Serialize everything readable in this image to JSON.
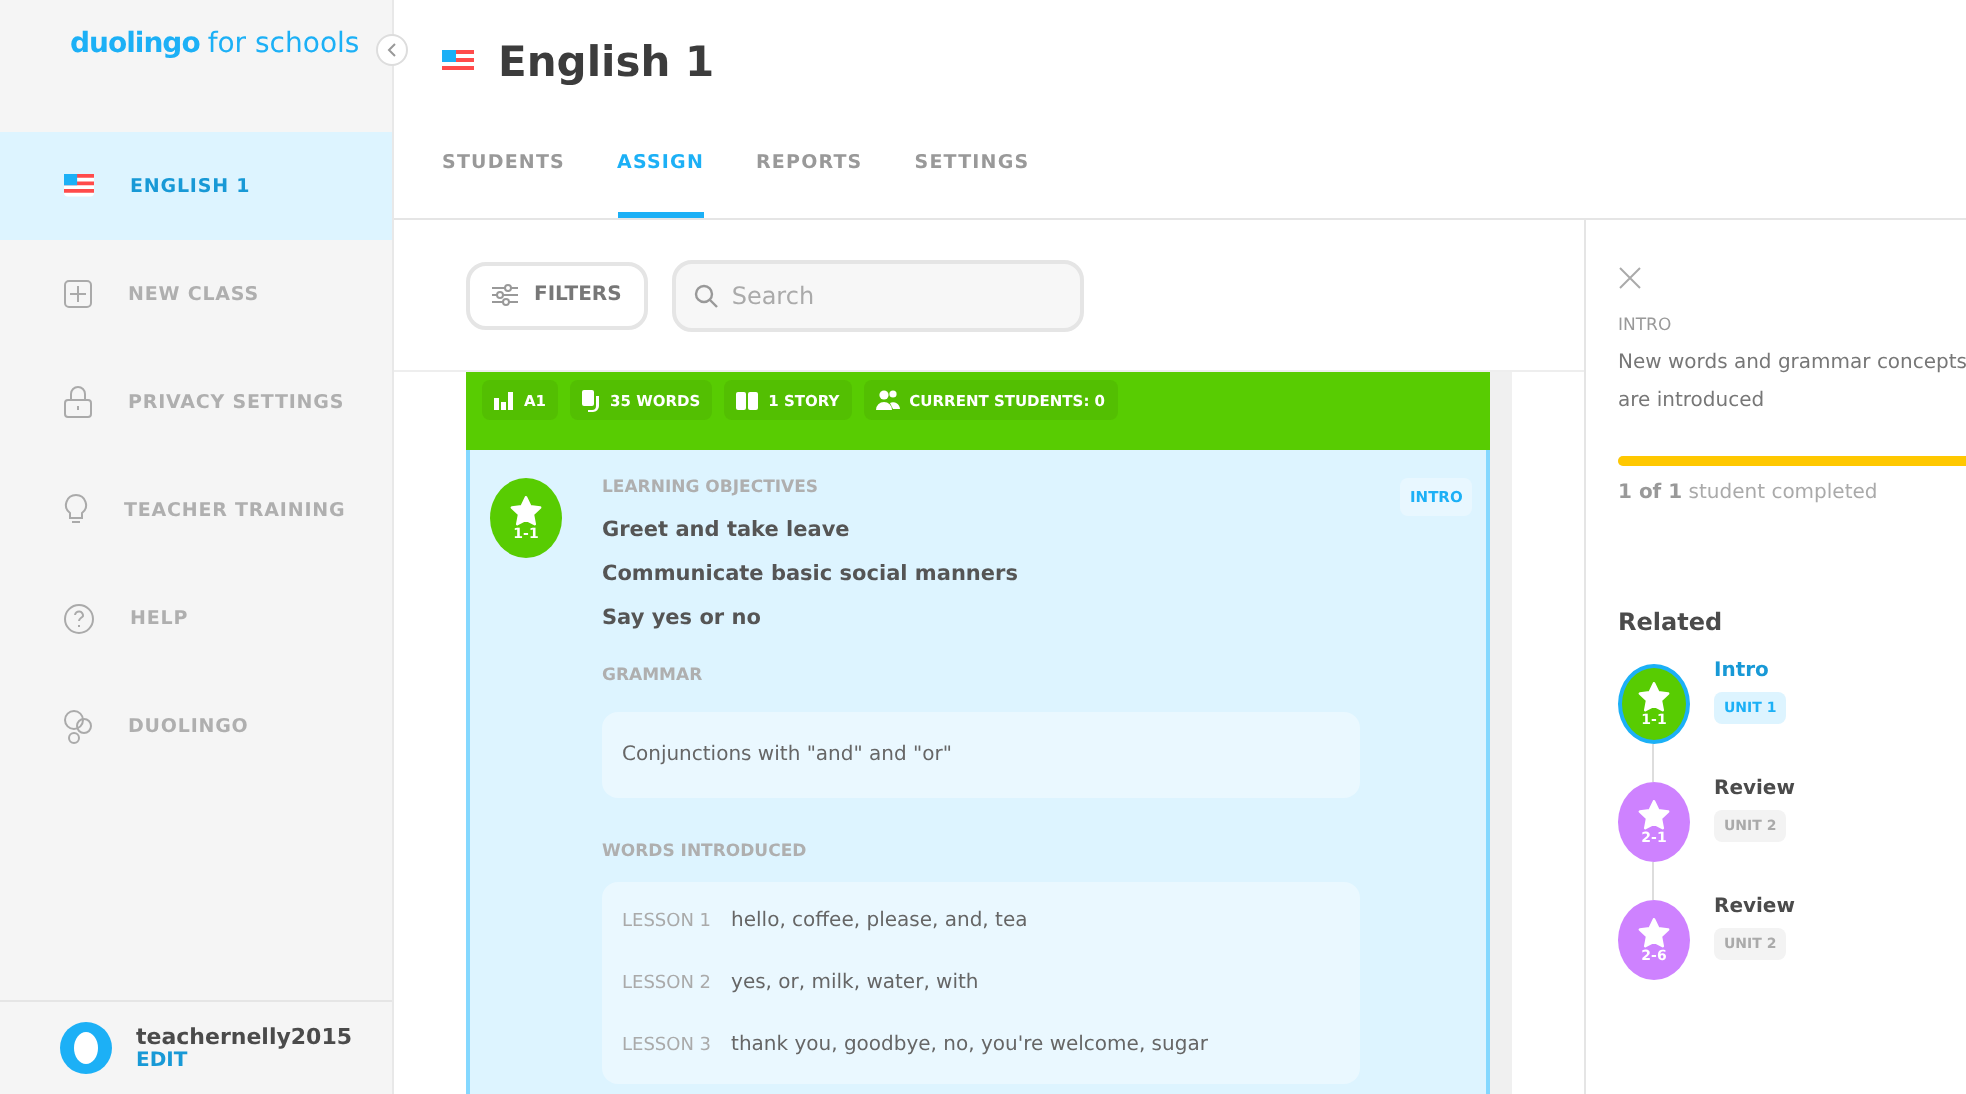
{
  "logo": {
    "brand": "duolingo",
    "suffix": "for schools"
  },
  "sidebar": {
    "items": [
      {
        "label": "ENGLISH 1",
        "selected": true
      },
      {
        "label": "NEW CLASS",
        "selected": false
      },
      {
        "label": "PRIVACY SETTINGS",
        "selected": false
      },
      {
        "label": "TEACHER TRAINING",
        "selected": false
      },
      {
        "label": "HELP",
        "selected": false
      },
      {
        "label": "DUOLINGO",
        "selected": false
      }
    ],
    "user": {
      "name": "teachernelly2015",
      "action": "EDIT"
    }
  },
  "header": {
    "title": "English 1"
  },
  "tabs": [
    {
      "label": "STUDENTS",
      "selected": false
    },
    {
      "label": "ASSIGN",
      "selected": true
    },
    {
      "label": "REPORTS",
      "selected": false
    },
    {
      "label": "SETTINGS",
      "selected": false
    }
  ],
  "toolbar": {
    "filters": "FILTERS",
    "search": {
      "placeholder": "Search"
    }
  },
  "card": {
    "stats": [
      {
        "label": "A1"
      },
      {
        "label": "35 WORDS"
      },
      {
        "label": "1 STORY"
      },
      {
        "label": "CURRENT STUDENTS: 0"
      }
    ],
    "badge": "1-1",
    "tag": "INTRO",
    "objectives_heading": "LEARNING OBJECTIVES",
    "objectives": [
      "Greet and take leave",
      "Communicate basic social manners",
      "Say yes or no"
    ],
    "grammar_heading": "GRAMMAR",
    "grammar": [
      "Conjunctions with \"and\" and \"or\""
    ],
    "words_heading": "WORDS INTRODUCED",
    "lessons": [
      {
        "lesson": "LESSON 1",
        "words": "hello, coffee, please, and, tea"
      },
      {
        "lesson": "LESSON 2",
        "words": "yes, or, milk, water, with"
      },
      {
        "lesson": "LESSON 3",
        "words": "thank you, goodbye, no, you're welcome, sugar"
      }
    ]
  },
  "panel": {
    "type": "INTRO",
    "description": "New words and grammar concepts are introduced",
    "progress": {
      "level": 1
    },
    "completed": "**1 of 1** student completed",
    "related_heading": "Related",
    "related": [
      {
        "title": "Intro",
        "unit": "UNIT 1",
        "badge": "1-1",
        "color": "#58cc02",
        "selected": true
      },
      {
        "title": "Review",
        "unit": "UNIT 2",
        "badge": "2-1",
        "color": "#ce82ff",
        "selected": false
      },
      {
        "title": "Review",
        "unit": "UNIT 2",
        "badge": "2-6",
        "color": "#ce82ff",
        "selected": false
      }
    ]
  }
}
